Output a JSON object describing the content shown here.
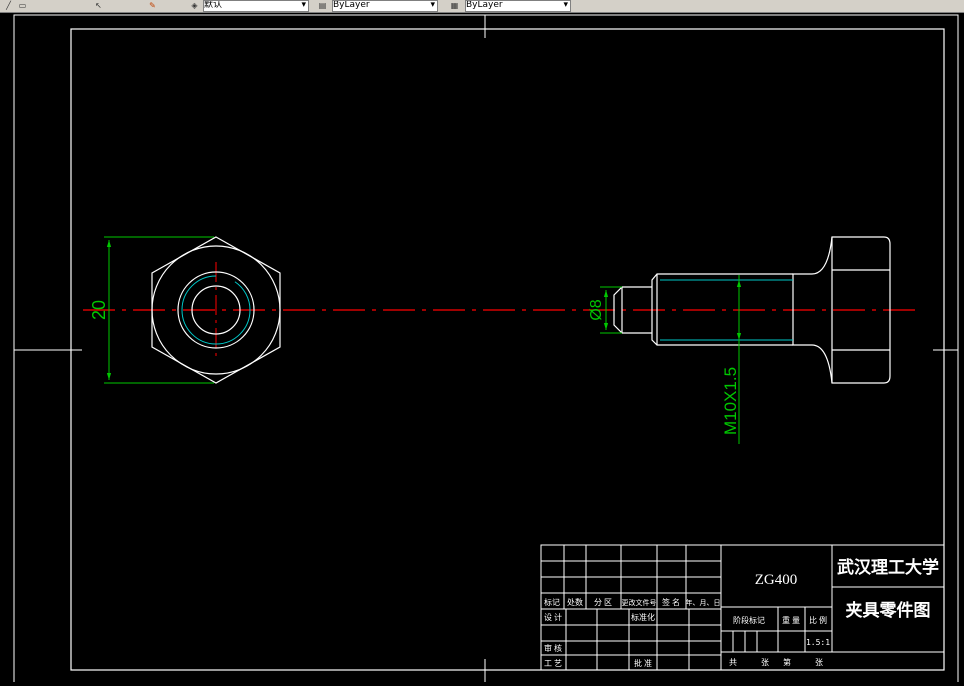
{
  "toolbar": {
    "layer_value": "默认",
    "linetype_value": "ByLayer",
    "lineweight_value": "ByLayer",
    "colors": {
      "bg": "#d4d0c8"
    }
  },
  "drawing": {
    "colors": {
      "background": "#000000",
      "outline": "#ffffff",
      "dimension": "#00c800",
      "centerline": "#ff0000",
      "thread": "#00c8c8"
    },
    "dim_height": "20",
    "dim_diameter": "Ø8",
    "dim_thread": "M10X1.5"
  },
  "title_block": {
    "part_code": "ZG400",
    "school": "武汉理工大学",
    "drawing_name": "夹具零件图",
    "scale_value": "1.5:1",
    "rev_headers": [
      "标记",
      "处数",
      "分 区",
      "更改文件号",
      "签 名",
      "年、月、日"
    ],
    "design_label": "设 计",
    "standardize_label": "标准化",
    "review_label": "审 核",
    "process_label": "工 艺",
    "approve_label": "批 准",
    "stage_label": "阶段标记",
    "weight_label": "重 量",
    "scale_label": "比 例",
    "total_label": "共",
    "sheets_label": "张",
    "sheet_no_label": "第",
    "sheet_label": "张"
  }
}
